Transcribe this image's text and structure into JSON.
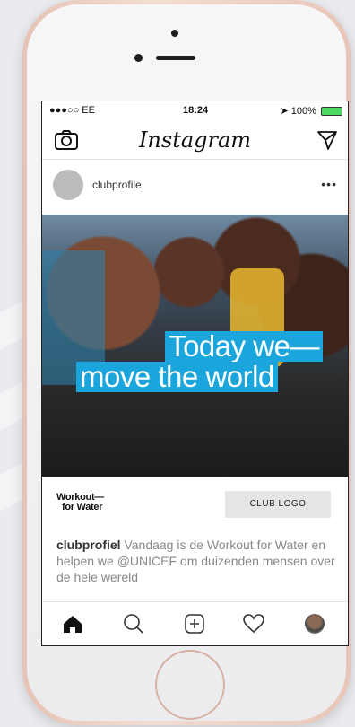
{
  "status_bar": {
    "carrier": "●●●○○ EE",
    "time": "18:24",
    "battery": "100%"
  },
  "nav": {
    "title": "Instagram"
  },
  "post": {
    "username": "clubprofile",
    "more": "•••",
    "headline_line1": "Today we—",
    "headline_line2": "move the world",
    "workout_line1": "Workout—",
    "workout_line2": "for Water",
    "club_logo": "CLUB LOGO",
    "caption_user": "clubprofiel",
    "caption_text": " Vandaag is de Workout for Water en helpen we @UNICEF om duizenden mensen over de hele wereld"
  },
  "colors": {
    "headline_bg": "#1aa6dc",
    "phone_frame": "#e6c3b6",
    "battery": "#4cd964"
  },
  "tab_icons": [
    "home-icon",
    "search-icon",
    "add-post-icon",
    "heart-icon",
    "profile-avatar"
  ]
}
